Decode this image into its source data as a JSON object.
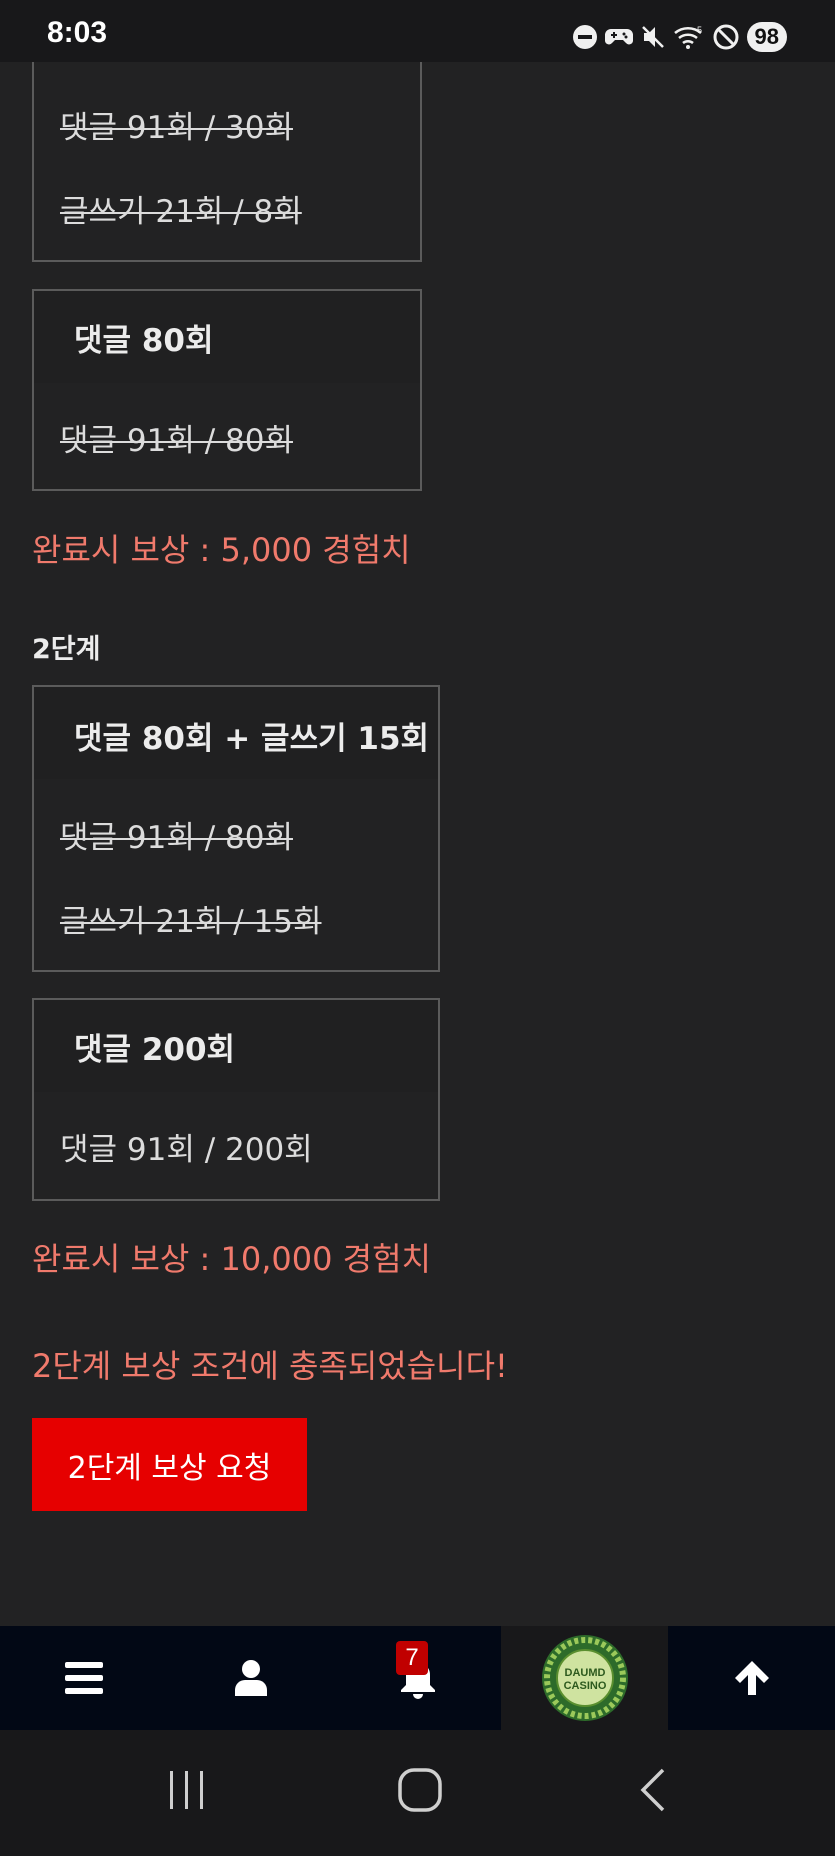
{
  "status_bar": {
    "time": "8:03",
    "battery": "98",
    "icons": [
      "dnd-icon",
      "game-controller-icon",
      "mute-icon",
      "wifi-icon",
      "blocked-icon"
    ]
  },
  "stage1": {
    "tasks": [
      {
        "title": "",
        "progress": [
          "댓글 91회 / 30회",
          "글쓰기 21회 / 8회"
        ],
        "completed": true
      },
      {
        "title": "댓글 80회",
        "progress": [
          "댓글 91회 / 80회"
        ],
        "completed": true
      }
    ],
    "reward": "완료시 보상 : 5,000 경험치"
  },
  "stage2": {
    "label": "2단계",
    "tasks": [
      {
        "title": "댓글 80회 + 글쓰기 15회",
        "progress": [
          "댓글 91회 / 80회",
          "글쓰기 21회 / 15회"
        ],
        "completed": true
      },
      {
        "title": "댓글 200회",
        "progress": [
          "댓글 91회 / 200회"
        ],
        "completed": false
      }
    ],
    "reward": "완료시 보상 : 10,000 경험치",
    "notice": "2단계 보상 조건에 충족되었습니다!",
    "button": "2단계 보상 요청"
  },
  "bottom_nav": {
    "items": [
      "menu-icon",
      "user-icon",
      "bell-icon",
      "logo",
      "arrow-up-icon"
    ],
    "notification_count": "7",
    "logo_text_line1": "DAUMD",
    "logo_text_line2": "CASINO"
  },
  "colors": {
    "background": "#222223",
    "accent_red": "#e60000",
    "reward_text": "#f07a6c",
    "nav_bg": "#020815"
  }
}
